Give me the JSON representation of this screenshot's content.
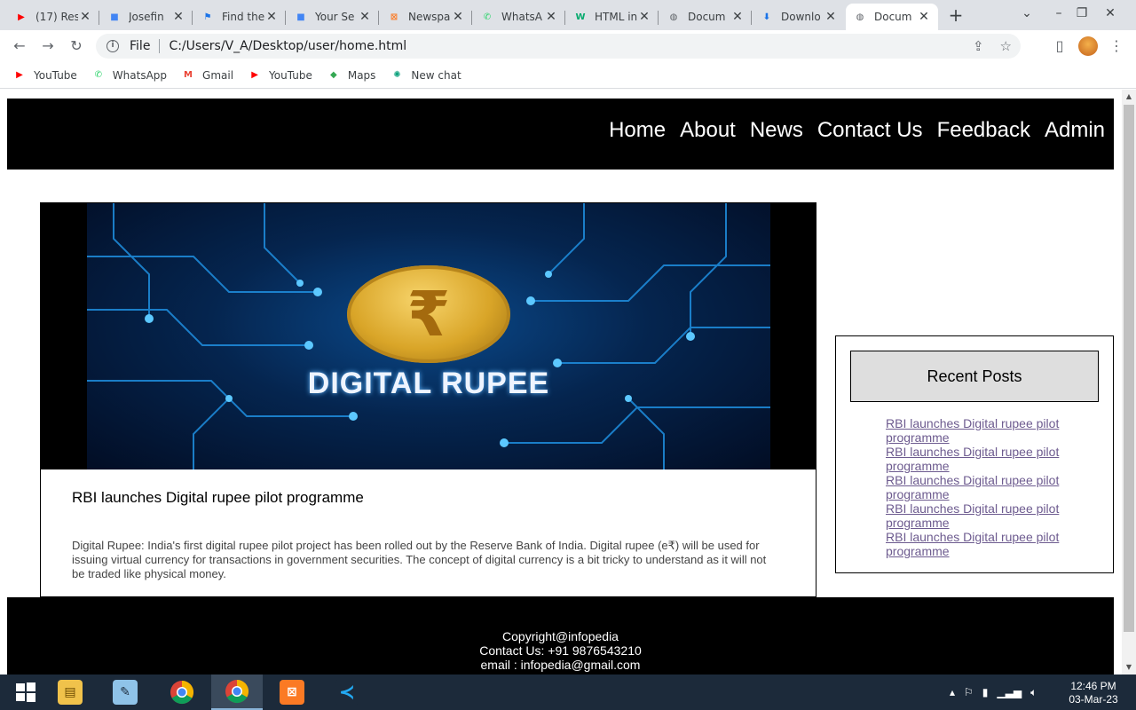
{
  "browser": {
    "tabs": [
      {
        "title": "(17) Res",
        "favicon": "youtube-icon",
        "color": "#ff0000",
        "glyph": "▶",
        "active": false
      },
      {
        "title": "Josefin",
        "favicon": "google-fonts-icon",
        "color": "#4285f4",
        "glyph": "■",
        "active": false
      },
      {
        "title": "Find the",
        "favicon": "flag-icon",
        "color": "#1a73e8",
        "glyph": "⚑",
        "active": false
      },
      {
        "title": "Your Se",
        "favicon": "google-fonts-icon",
        "color": "#4285f4",
        "glyph": "■",
        "active": false
      },
      {
        "title": "Newspa",
        "favicon": "xampp-icon",
        "color": "#fb7a24",
        "glyph": "⊠",
        "active": false
      },
      {
        "title": "WhatsA",
        "favicon": "whatsapp-icon",
        "color": "#25d366",
        "glyph": "✆",
        "active": false
      },
      {
        "title": "HTML in",
        "favicon": "w3schools-icon",
        "color": "#04aa6d",
        "glyph": "W",
        "active": false
      },
      {
        "title": "Docum",
        "favicon": "globe-icon",
        "color": "#5f6368",
        "glyph": "◍",
        "active": false
      },
      {
        "title": "Downlo",
        "favicon": "download-icon",
        "color": "#1a73e8",
        "glyph": "⬇",
        "active": false
      },
      {
        "title": "Docum",
        "favicon": "globe-icon",
        "color": "#5f6368",
        "glyph": "◍",
        "active": true
      }
    ],
    "address": "C:/Users/V_A/Desktop/user/home.html",
    "scheme_label": "File",
    "bookmarks": [
      {
        "label": "YouTube",
        "icon": "youtube-icon",
        "color": "#ff0000",
        "glyph": "▶"
      },
      {
        "label": "WhatsApp",
        "icon": "whatsapp-icon",
        "color": "#25d366",
        "glyph": "✆"
      },
      {
        "label": "Gmail",
        "icon": "gmail-icon",
        "color": "#ea4335",
        "glyph": "M"
      },
      {
        "label": "YouTube",
        "icon": "youtube-icon",
        "color": "#ff0000",
        "glyph": "▶"
      },
      {
        "label": "Maps",
        "icon": "maps-icon",
        "color": "#34a853",
        "glyph": "◆"
      },
      {
        "label": "New chat",
        "icon": "chatgpt-icon",
        "color": "#10a37f",
        "glyph": "✺"
      }
    ]
  },
  "site": {
    "nav": [
      "Home",
      "About",
      "News",
      "Contact Us",
      "Feedback",
      "Admin"
    ],
    "hero_text": "DIGITAL RUPEE",
    "hero_symbol": "₹",
    "article_title": "RBI launches Digital rupee pilot programme",
    "article_body": "Digital Rupee: India's first digital rupee pilot project has been rolled out by the Reserve Bank of India. Digital rupee (e₹) will be used for issuing virtual currency for transactions in government securities. The concept of digital currency is a bit tricky to understand as it will not be traded like physical money.",
    "sidebar_title": "Recent Posts",
    "recent_posts": [
      "RBI launches Digital rupee pilot programme",
      "RBI launches Digital rupee pilot programme",
      "RBI launches Digital rupee pilot programme",
      "RBI launches Digital rupee pilot programme",
      "RBI launches Digital rupee pilot programme"
    ],
    "footer": {
      "copyright": "Copyright@infopedia",
      "contact": "Contact Us: +91 9876543210",
      "email": "email : infopedia@gmail.com"
    }
  },
  "taskbar": {
    "apps": [
      {
        "name": "windows-start-icon",
        "running": false
      },
      {
        "name": "file-explorer-icon",
        "running": false
      },
      {
        "name": "notepad-icon",
        "running": false
      },
      {
        "name": "chrome-icon",
        "running": false
      },
      {
        "name": "chrome-profile-icon",
        "running": true
      },
      {
        "name": "xampp-icon",
        "running": false
      },
      {
        "name": "vscode-icon",
        "running": false
      }
    ],
    "time": "12:46 PM",
    "date": "03-Mar-23"
  }
}
